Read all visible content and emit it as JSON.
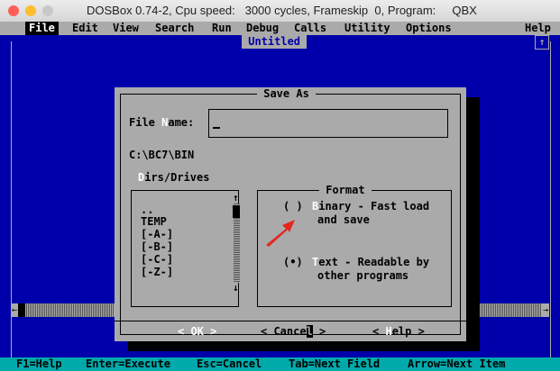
{
  "window": {
    "title": "DOSBox 0.74-2, Cpu speed:   3000 cycles, Frameskip  0, Program:     QBX",
    "lights": [
      "#ff5f57",
      "#ffbd2e",
      "#c8c8c8"
    ]
  },
  "menubar": {
    "items": [
      "File",
      "Edit",
      "View",
      "Search",
      "Run",
      "Debug",
      "Calls",
      "Utility",
      "Options",
      "Help"
    ]
  },
  "editor": {
    "document_title": " Untitled "
  },
  "dialog": {
    "title": " Save As ",
    "filename_label_a": "File ",
    "filename_hot": "N",
    "filename_label_b": "ame:",
    "filename_value": "",
    "current_path": "C:\\BC7\\BIN",
    "dirs_hot": "D",
    "dirs_label": "irs/Drives",
    "dir_items": [
      "..",
      "TEMP",
      "[-A-]",
      "[-B-]",
      "[-C-]",
      "[-Z-]"
    ],
    "format": {
      "title": " Format ",
      "binary_radio": "( )",
      "binary_hot": "B",
      "binary_label_1": "inary - Fast load",
      "binary_label_2": "and save",
      "text_radio": "(•)",
      "text_hot": "T",
      "text_label_1": "ext - Readable by",
      "text_label_2": "other programs"
    },
    "buttons": {
      "ok": "< OK >",
      "cancel_a": "< Cance",
      "cancel_b": "l",
      "cancel_c": " >",
      "help_a": "< ",
      "help_hot": "H",
      "help_b": "elp >"
    }
  },
  "statusbar": {
    "items": [
      "F1=Help",
      "Enter=Execute",
      "Esc=Cancel",
      "Tab=Next Field",
      "Arrow=Next Item"
    ]
  },
  "colors": {
    "dos_blue": "#0000aa",
    "dos_gray": "#aaaaaa",
    "dos_cyan": "#00aaaa",
    "arrow_red": "#e0281e"
  }
}
